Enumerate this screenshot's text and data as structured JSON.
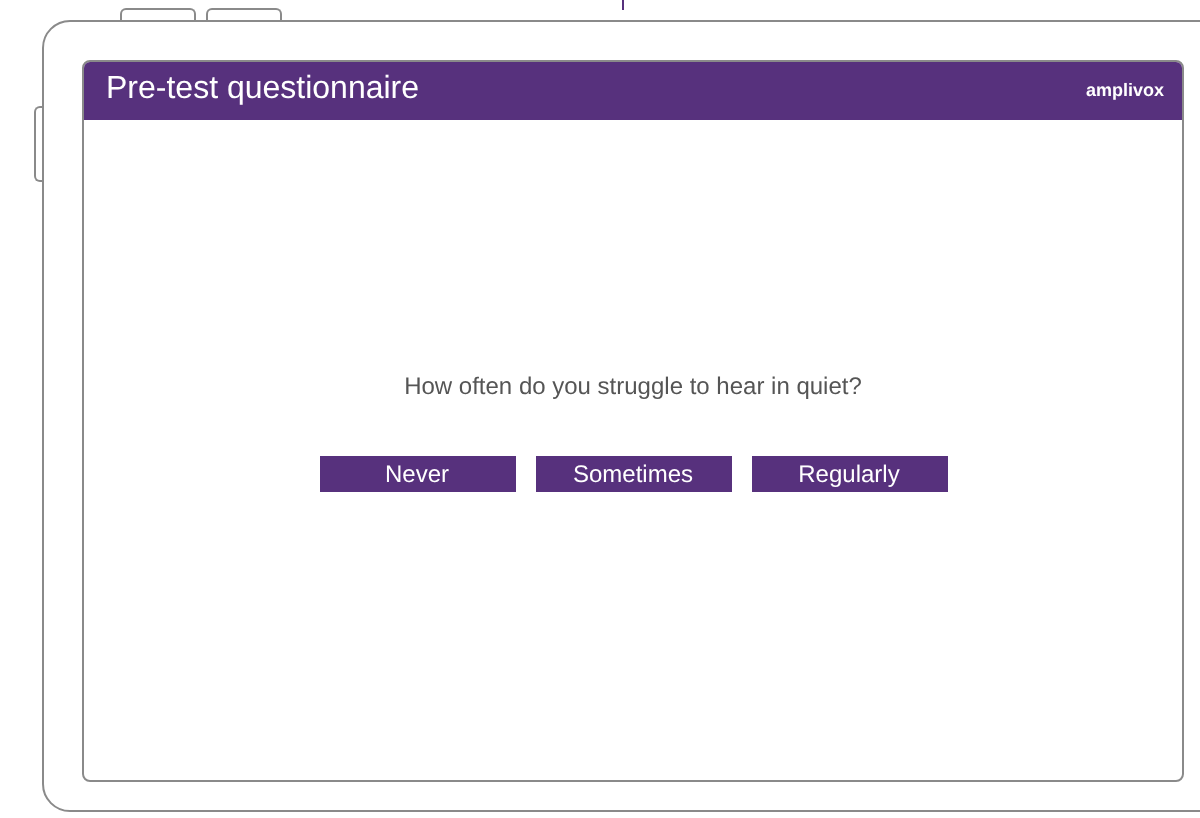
{
  "header": {
    "title": "Pre-test questionnaire",
    "brand": "amplivox"
  },
  "question": "How often do you struggle to hear in quiet?",
  "answers": [
    "Never",
    "Sometimes",
    "Regularly"
  ]
}
